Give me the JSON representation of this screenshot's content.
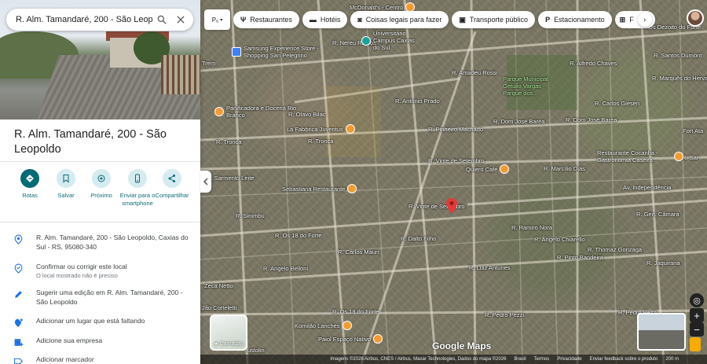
{
  "search": {
    "value": "R. Alm. Tamandaré, 200 - São Leopo"
  },
  "place": {
    "title": "R. Alm. Tamandaré, 200 - São Leopoldo"
  },
  "actions": [
    {
      "label": "Rotas",
      "icon": "directions-icon"
    },
    {
      "label": "Salvar",
      "icon": "bookmark-icon"
    },
    {
      "label": "Próximo",
      "icon": "nearby-icon"
    },
    {
      "label": "Enviar para o smartphone",
      "icon": "phone-icon"
    },
    {
      "label": "Compartilhar",
      "icon": "share-icon"
    }
  ],
  "info": {
    "address": "R. Alm. Tamandaré, 200 - São Leopoldo, Caxias do Sul - RS, 95080-340",
    "confirm": "Confirmar ou corrigir este local",
    "confirm_sub": "O local mostrado não é preciso",
    "suggest": "Sugerir uma edição em R. Alm. Tamandaré, 200 - São Leopoldo",
    "add_place": "Adicionar um lugar que está faltando",
    "add_business": "Adicione sua empresa",
    "add_label": "Adicionar marcador"
  },
  "chips": {
    "layer": "P₆",
    "items": [
      "Restaurantes",
      "Hotéis",
      "Coisas legais para fazer",
      "Transporte público",
      "Estacionamento",
      "F"
    ]
  },
  "map": {
    "streets": [
      "R. Tronca",
      "R. Tronca",
      "R. Olavo Bilac",
      "R. Antônio Prado",
      "R. Dom José Barea",
      "R. Dom José Barea",
      "R. Carlos Giesen",
      "Av. Independência",
      "R. Gen. Câmara",
      "R. Dalto Filho",
      "R. Carlos Mauri",
      "R. Angelo Belloni",
      "R. Pedro Pezzi",
      "R. Pedro Pezzi",
      "R. Santos Dumont",
      "R. Marcílio Dias",
      "R. Ramiro Nora",
      "R. Ângelo Chiarello",
      "R. Luiz Antunes",
      "R. Alfredo Chaves",
      "Os Dezoito do Forte",
      "R. Sarmento Leite",
      "Fort Ata",
      "R. Sar",
      "Zeca Netto",
      "Jão Corteletti",
      "R. Sinimbu",
      "R. Pinheiro Machado",
      "R. Os 18 do Forte",
      "R. Os 18 do Forte",
      "R. Jaquirana",
      "R. Marquês do Herval",
      "R. Thomaz Gonzaga",
      "R. Pinto Bandeira",
      "R. Amadeu Rossi",
      "R. Nereu Ramos",
      "R. Vinte de Setembro",
      "R. Vinte de Setembro",
      "Trem",
      "ustolin"
    ],
    "pois": [
      {
        "name": "Panificadora e Doceria Rio Branco",
        "kind": "food"
      },
      {
        "name": "La Fabbrica Juventus",
        "kind": "food"
      },
      {
        "name": "Sebastiana Restaurante",
        "kind": "food"
      },
      {
        "name": "Quiero Café",
        "kind": "food"
      },
      {
        "name": "Restaurante Cocanha - Gastronomia Caseira",
        "kind": "food"
      },
      {
        "name": "Komilão Lanches",
        "kind": "food"
      },
      {
        "name": "Paiol Espaço Nativo",
        "kind": "food"
      },
      {
        "name": "Samsung Experience Store - Shopping San Pelegrino",
        "kind": "shop"
      },
      {
        "name": "Universitário Campus Caxias do Sul",
        "kind": "school"
      },
      {
        "name": "Parque Municipal Getúlio Vargas - Parque dos...",
        "kind": "park"
      },
      {
        "name": "McDonald's - Centro",
        "kind": "food"
      }
    ],
    "layers_label": "Camadas",
    "google": "Google Maps",
    "footer": [
      "Imagens ©2026 Airbus, CNES / Airbus, Maxar Technologies, Dados do mapa ©2026",
      "Brasil",
      "Termos",
      "Privacidade",
      "Enviar feedback sobre o produto",
      "200 m"
    ]
  }
}
